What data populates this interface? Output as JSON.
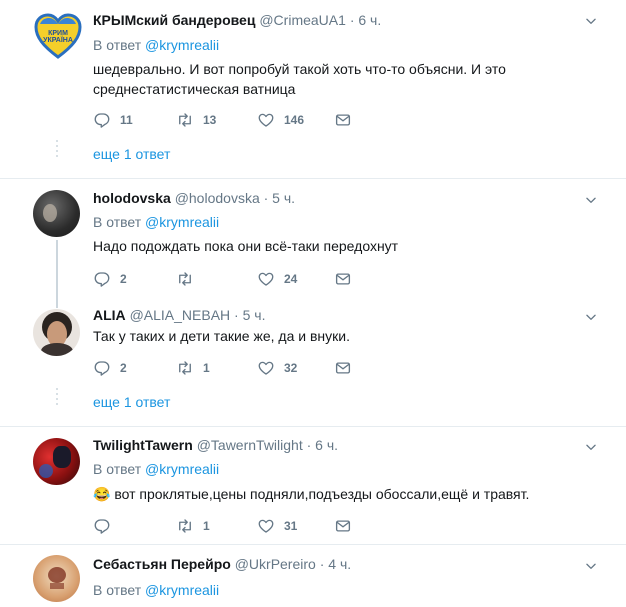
{
  "reply_prefix": "В ответ",
  "tweets": [
    {
      "name": "КРЫМский бандеровец",
      "handle": "@CrimeaUA1",
      "time": "· 6 ч.",
      "reply_to": "@krymrealii",
      "text": "шедеврально. И вот попробуй такой хоть что-то объясни. И это среднестатистическая ватница",
      "replies": "11",
      "retweets": "13",
      "likes": "146",
      "avatar_text": "КРИМ УКРАЇНА",
      "more": "еще 1 ответ"
    },
    {
      "name": "holodovska",
      "handle": "@holodovska",
      "time": "· 5 ч.",
      "reply_to": "@krymrealii",
      "text": "Надо подождать пока они всё-таки передохнут",
      "replies": "2",
      "retweets": "",
      "likes": "24"
    },
    {
      "name": "ALIA",
      "handle": "@ALIA_NEBAH",
      "time": "· 5 ч.",
      "reply_to": "",
      "text": "Так у таких и дети такие же, да и внуки.",
      "replies": "2",
      "retweets": "1",
      "likes": "32",
      "more": "еще 1 ответ"
    },
    {
      "name": "TwilightTawern",
      "handle": "@TawernTwilight",
      "time": "· 6 ч.",
      "reply_to": "@krymrealii",
      "text": "😂 вот проклятые,цены подняли,подъезды обоссали,ещё и травят.",
      "replies": "",
      "retweets": "1",
      "likes": "31"
    },
    {
      "name": "Себастьян Перейро",
      "handle": "@UkrPereiro",
      "time": "· 4 ч.",
      "reply_to": "@krymrealii"
    }
  ],
  "colors": {
    "link": "#1b95e0",
    "muted": "#657786",
    "text": "#14171a",
    "line": "#e6ecf0"
  },
  "icons": [
    "reply-icon",
    "retweet-icon",
    "like-icon",
    "dm-icon",
    "chevron-down-icon"
  ]
}
